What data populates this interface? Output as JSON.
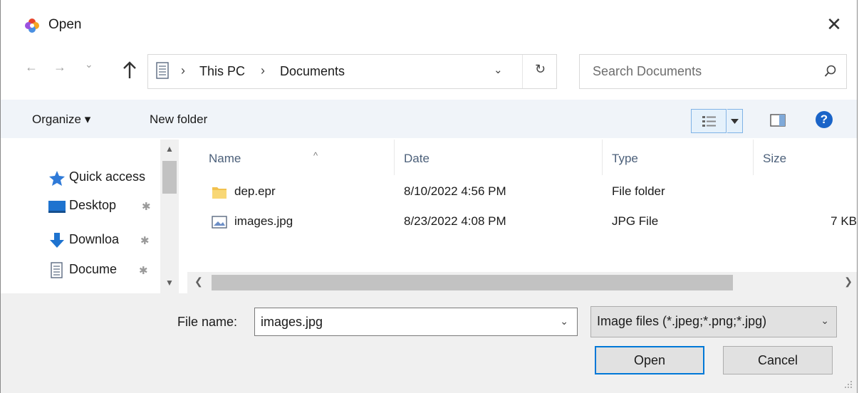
{
  "window": {
    "title": "Open",
    "close_glyph": "✕"
  },
  "nav": {
    "back": "←",
    "forward": "→",
    "recent": "⌄"
  },
  "address": {
    "breadcrumbs": [
      "This PC",
      "Documents"
    ],
    "separator": "›",
    "dropdown_glyph": "⌄",
    "refresh_glyph": "↻"
  },
  "search": {
    "placeholder": "Search Documents"
  },
  "toolbar": {
    "organize": "Organize ▾",
    "new_folder": "New folder",
    "help": "?"
  },
  "sidebar": {
    "items": [
      {
        "label": "Quick access",
        "icon": "star-icon",
        "pinned": false
      },
      {
        "label": "Desktop",
        "icon": "desktop-icon",
        "pinned": true
      },
      {
        "label": "Downloa",
        "icon": "download-icon",
        "pinned": true
      },
      {
        "label": "Docume",
        "icon": "document-icon",
        "pinned": true
      }
    ],
    "pin_glyph": "✱"
  },
  "filelist": {
    "columns": [
      "Name",
      "Date",
      "Type",
      "Size"
    ],
    "sort_glyph": "^",
    "rows": [
      {
        "name": "dep.epr",
        "date": "8/10/2022 4:56 PM",
        "type": "File folder",
        "size": "",
        "icon": "folder-icon"
      },
      {
        "name": "images.jpg",
        "date": "8/23/2022 4:08 PM",
        "type": "JPG File",
        "size": "7 KB",
        "icon": "image-file-icon"
      }
    ]
  },
  "footer": {
    "file_name_label": "File name:",
    "file_name_value": "images.jpg",
    "filter_value": "Image files (*.jpeg;*.png;*.jpg)",
    "dropdown_glyph": "⌄",
    "open_label": "Open",
    "cancel_label": "Cancel"
  },
  "colors": {
    "accent": "#0078d7",
    "toolbar_bg": "#f0f4f9",
    "header_text": "#4c607a",
    "help_blue": "#1a64c8"
  }
}
